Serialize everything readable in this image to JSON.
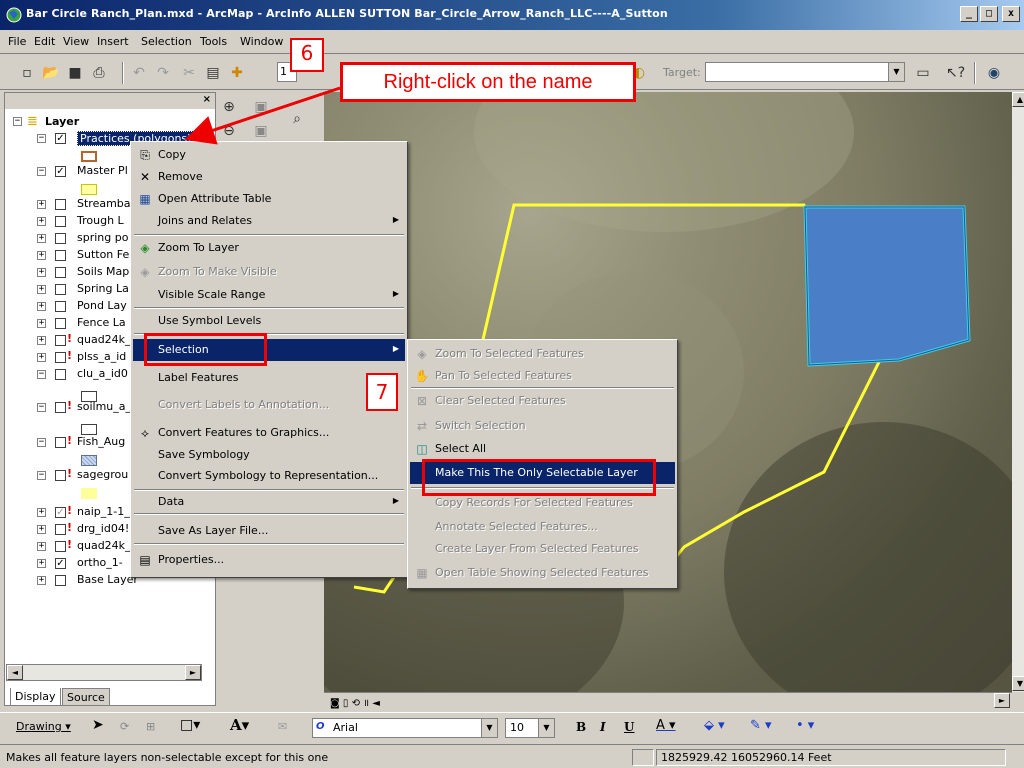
{
  "window": {
    "title": "Bar Circle Ranch_Plan.mxd - ArcMap - ArcInfo     ALLEN SUTTON     Bar_Circle_Arrow_Ranch_LLC----A_Sutton",
    "controls": [
      "_",
      "□",
      "x"
    ]
  },
  "menu": [
    "File",
    "Edit",
    "View",
    "Insert",
    "Selection",
    "Tools",
    "Window"
  ],
  "toolbar": {
    "scale_value": "1",
    "target_label": "Target:"
  },
  "toc": {
    "root": "Layer",
    "layers": [
      {
        "label": "Practices (polygons)",
        "checked": true,
        "warn": false
      },
      {
        "label": "Master Pl",
        "checked": true,
        "warn": false
      },
      {
        "label": "Streamba",
        "checked": false,
        "warn": false
      },
      {
        "label": "Trough L",
        "checked": false,
        "warn": false
      },
      {
        "label": "spring po",
        "checked": false,
        "warn": false
      },
      {
        "label": "Sutton Fe",
        "checked": false,
        "warn": false
      },
      {
        "label": "Soils Map",
        "checked": false,
        "warn": false
      },
      {
        "label": "Spring La",
        "checked": false,
        "warn": false
      },
      {
        "label": "Pond Lay",
        "checked": false,
        "warn": false
      },
      {
        "label": "Fence La",
        "checked": false,
        "warn": false
      },
      {
        "label": "quad24k_",
        "checked": false,
        "warn": true
      },
      {
        "label": "plss_a_id",
        "checked": false,
        "warn": true
      },
      {
        "label": "clu_a_id0",
        "checked": false,
        "warn": false
      },
      {
        "label": "soilmu_a_",
        "checked": false,
        "warn": true
      },
      {
        "label": "Fish_Aug",
        "checked": false,
        "warn": true
      },
      {
        "label": "sagegrou",
        "checked": false,
        "warn": true
      },
      {
        "label": "naip_1-1_",
        "checked": true,
        "warn": true
      },
      {
        "label": "drg_id04!",
        "checked": false,
        "warn": true
      },
      {
        "label": "quad24k_",
        "checked": false,
        "warn": true
      },
      {
        "label": "ortho_1-",
        "checked": true,
        "warn": false
      },
      {
        "label": "Base Layer",
        "checked": false,
        "warn": false
      }
    ],
    "tabs": [
      "Display",
      "Source"
    ]
  },
  "context_menu": {
    "items": [
      {
        "label": "Copy",
        "icon": "copy-icon",
        "disabled": false
      },
      {
        "label": "Remove",
        "icon": "remove-icon",
        "disabled": false
      },
      {
        "label": "Open Attribute Table",
        "icon": "table-icon",
        "disabled": false
      },
      {
        "label": "Joins and Relates",
        "icon": "",
        "disabled": false,
        "submenu": true
      },
      {
        "label": "Zoom To Layer",
        "icon": "zoom-layer-icon",
        "disabled": false
      },
      {
        "label": "Zoom To Make Visible",
        "icon": "zoom-visible-icon",
        "disabled": true
      },
      {
        "label": "Visible Scale Range",
        "icon": "",
        "disabled": false,
        "submenu": true
      },
      {
        "label": "Use Symbol Levels",
        "icon": "",
        "disabled": false
      },
      {
        "label": "Selection",
        "icon": "",
        "disabled": false,
        "submenu": true,
        "highlight": true
      },
      {
        "label": "Label Features",
        "icon": "",
        "disabled": false
      },
      {
        "label": "Convert Labels to Annotation...",
        "icon": "",
        "disabled": true
      },
      {
        "label": "Convert Features to Graphics...",
        "icon": "convert-graphics-icon",
        "disabled": false
      },
      {
        "label": "Save Symbology",
        "icon": "",
        "disabled": false
      },
      {
        "label": "Convert Symbology to Representation...",
        "icon": "",
        "disabled": false
      },
      {
        "label": "Data",
        "icon": "",
        "disabled": false,
        "submenu": true
      },
      {
        "label": "Save As Layer File...",
        "icon": "",
        "disabled": false
      },
      {
        "label": "Properties...",
        "icon": "properties-icon",
        "disabled": false
      }
    ]
  },
  "selection_submenu": {
    "items": [
      {
        "label": "Zoom To Selected Features",
        "disabled": true
      },
      {
        "label": "Pan To Selected Features",
        "disabled": true
      },
      {
        "label": "Clear Selected Features",
        "disabled": true
      },
      {
        "label": "Switch Selection",
        "disabled": true
      },
      {
        "label": "Select All",
        "disabled": false
      },
      {
        "label": "Make This The Only Selectable Layer",
        "disabled": false,
        "highlight": true
      },
      {
        "label": "Copy Records For Selected Features",
        "disabled": true
      },
      {
        "label": "Annotate Selected Features...",
        "disabled": true
      },
      {
        "label": "Create Layer From Selected Features",
        "disabled": true
      },
      {
        "label": "Open Table Showing Selected Features",
        "disabled": true
      }
    ]
  },
  "callouts": {
    "step6": "6",
    "step7": "7",
    "instruction": "Right-click on the name"
  },
  "drawing": {
    "drawing_label": "Drawing",
    "font_name": "Arial",
    "font_size": "10"
  },
  "status": {
    "message": "Makes all feature layers non-selectable except for this one",
    "coordinates": "1825929.42  16052960.14 Feet"
  },
  "colors": {
    "highlight": "#0a246a",
    "callout_red": "#e00000",
    "polygon_fill": "#4a7fc8",
    "polygon_outline": "#37d3e8",
    "boundary_yellow": "#ffff33"
  }
}
